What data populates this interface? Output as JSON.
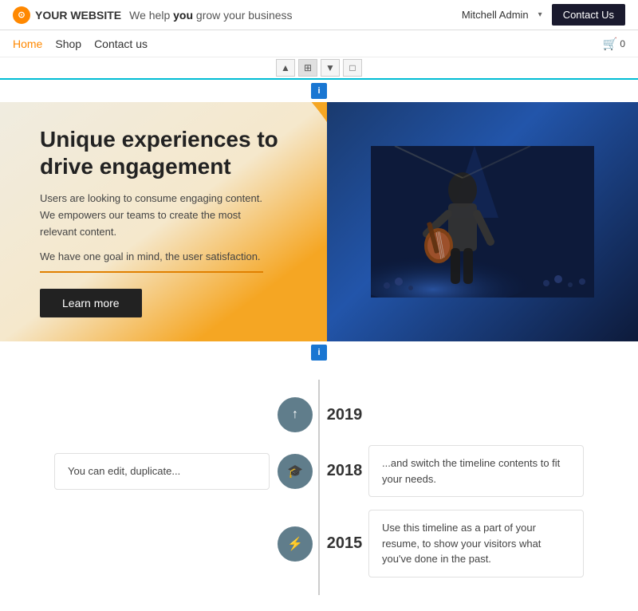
{
  "header": {
    "logo_text": "YOUR WEBSITE",
    "tagline_plain": "We help ",
    "tagline_bold": "you",
    "tagline_rest": " grow your business",
    "user": "Mitchell Admin",
    "contact_btn": "Contact Us"
  },
  "nav": {
    "items": [
      "Home",
      "Shop",
      "Contact us"
    ],
    "cart_count": "0"
  },
  "toolbar": {
    "buttons": [
      "▲",
      "⊞",
      "▼",
      "□"
    ]
  },
  "hero": {
    "title": "Unique experiences to drive engagement",
    "desc1": "Users are looking to consume engaging content. We empowers our teams to create the most relevant content.",
    "desc2": "We have one goal in mind, the user satisfaction.",
    "learn_more": "Learn more"
  },
  "timeline": {
    "items": [
      {
        "year": "2019",
        "icon": "↑",
        "side": "right",
        "text": ""
      },
      {
        "year": "2018",
        "icon": "🎓",
        "side": "both",
        "left_text": "You can edit, duplicate...",
        "right_text": "...and switch the timeline contents to fit your needs."
      },
      {
        "year": "2015",
        "icon": "⚡",
        "side": "right",
        "text": "Use this timeline as a part of your resume, to show your visitors what you've done in the past."
      }
    ]
  }
}
